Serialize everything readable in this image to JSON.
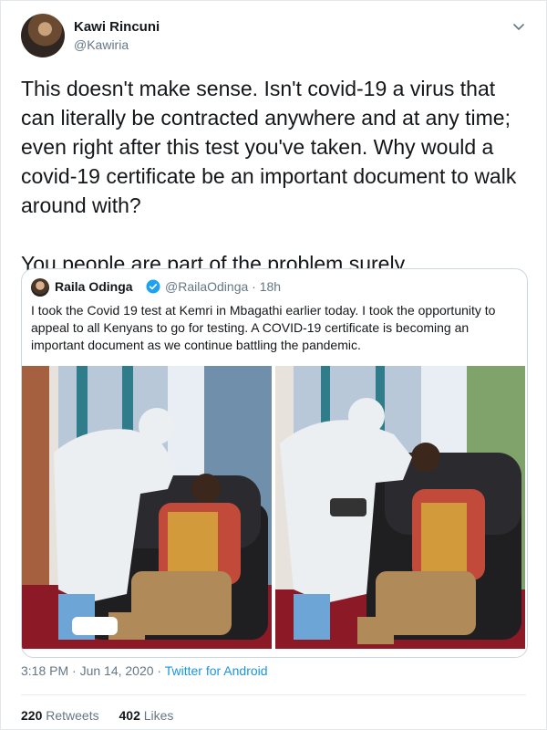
{
  "author": {
    "name": "Kawi Rincuni",
    "handle": "@Kawiria"
  },
  "tweet": {
    "paragraph1": "This doesn't make sense. Isn't covid-19 a virus that can literally be contracted anywhere and at any time; even right after this test you've taken. Why would a covid-19 certificate be an important document to walk around with?",
    "paragraph2": "You people are part of the problem surely."
  },
  "quoted": {
    "name": "Raila Odinga",
    "handle_time": "@RailaOdinga · 18h",
    "text": "I took the Covid 19 test at Kemri in Mbagathi earlier today. I took the opportunity to appeal to all Kenyans to go for testing. A COVID-19 certificate is becoming an important document as we continue battling the pandemic."
  },
  "meta": {
    "timestamp": "3:18 PM · Jun 14, 2020 · ",
    "source": "Twitter for Android"
  },
  "stats": {
    "retweets_count": "220",
    "retweets_label": "Retweets",
    "likes_count": "402",
    "likes_label": "Likes"
  },
  "colors": {
    "link": "#1b95e0",
    "verified": "#1da1f2",
    "secondary_text": "#657786"
  },
  "icons": {
    "more": "chevron-down-icon",
    "verified": "verified-badge-icon"
  }
}
